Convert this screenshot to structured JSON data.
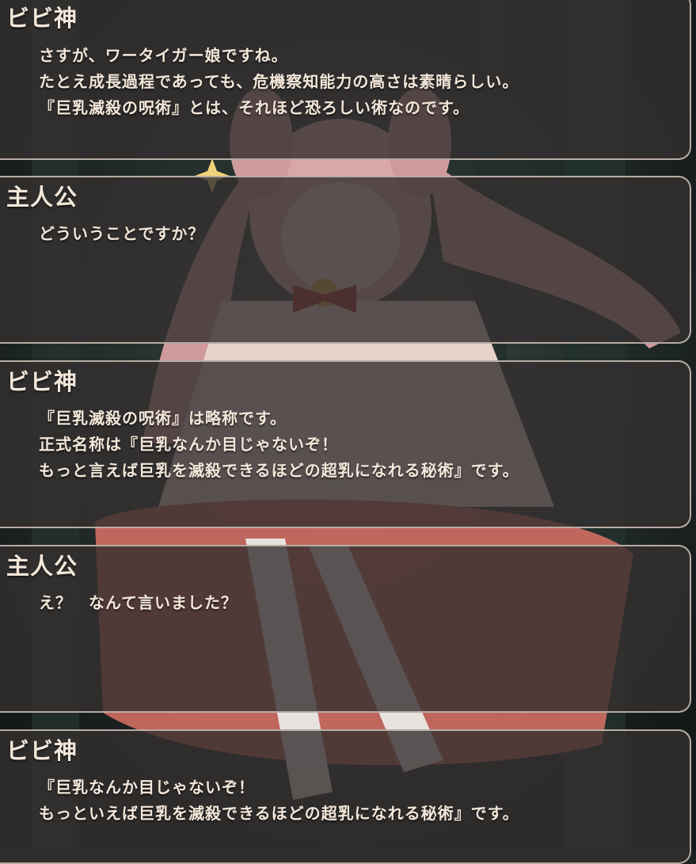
{
  "log": [
    {
      "speaker": "ビビ神",
      "lines": [
        "さすが、ワータイガー娘ですね。",
        "たとえ成長過程であっても、危機察知能力の高さは素晴らしい。",
        "『巨乳滅殺の呪術』とは、それほど恐ろしい術なのです。"
      ]
    },
    {
      "speaker": "主人公",
      "lines": [
        "どういうことですか？"
      ]
    },
    {
      "speaker": "ビビ神",
      "lines": [
        "『巨乳滅殺の呪術』は略称です。",
        "正式名称は『巨乳なんか目じゃないぞ！",
        "もっと言えば巨乳を滅殺できるほどの超乳になれる秘術』です。"
      ]
    },
    {
      "speaker": "主人公",
      "lines": [
        "え？　なんて言いました？"
      ]
    },
    {
      "speaker": "ビビ神",
      "lines": [
        "『巨乳なんか目じゃないぞ！",
        "もっといえば巨乳を滅殺できるほどの超乳になれる秘術』です。"
      ]
    }
  ],
  "colors": {
    "panel_fill": "#343030",
    "panel_border": "#b8aca4",
    "text": "#f3e7da",
    "background": "#1c2322",
    "character_hair": "#d9a0a2",
    "character_dress": "#f0dcd4",
    "skirt": "#c86a60"
  },
  "icons": {
    "sparkle": "four-point-star"
  }
}
